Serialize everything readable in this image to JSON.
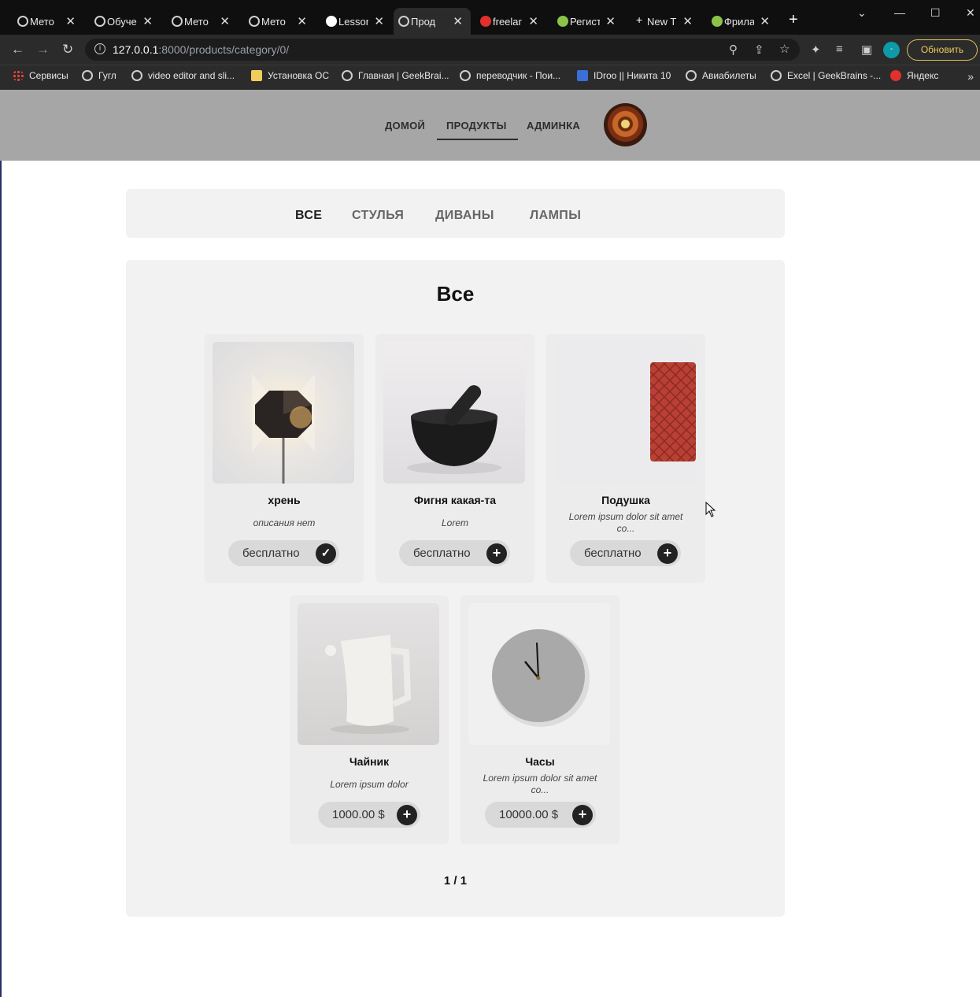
{
  "browser": {
    "tabs": [
      {
        "label": "Мето"
      },
      {
        "label": "Обуче"
      },
      {
        "label": "Мето"
      },
      {
        "label": "Мето"
      },
      {
        "label": "Lessor"
      },
      {
        "label": "Прод"
      },
      {
        "label": "freelar"
      },
      {
        "label": "Регист"
      },
      {
        "label": "New T"
      },
      {
        "label": "Фрила"
      }
    ],
    "url_host": "127.0.0.1",
    "url_rest": ":8000/products/category/0/",
    "profile_initial": "-",
    "update_label": "Обновить",
    "bookmarks": [
      {
        "label": "Сервисы"
      },
      {
        "label": "Гугл"
      },
      {
        "label": "video editor and sli..."
      },
      {
        "label": "Установка ОС"
      },
      {
        "label": "Главная | GeekBrai..."
      },
      {
        "label": "переводчик - Пои..."
      },
      {
        "label": "IDroo || Никита 10"
      },
      {
        "label": "Авиабилеты"
      },
      {
        "label": "Excel | GeekBrains -..."
      },
      {
        "label": "Яндекс"
      }
    ]
  },
  "site": {
    "nav": {
      "home": "ДОМОЙ",
      "products": "ПРОДУКТЫ",
      "admin": "АДМИНКА"
    },
    "categories": [
      "ВСЕ",
      "СТУЛЬЯ",
      "ДИВАНЫ",
      "ЛАМПЫ"
    ],
    "title": "Все",
    "products": [
      {
        "name": "хрень",
        "desc": "описания нет",
        "price": "бесплатно",
        "action": "✓"
      },
      {
        "name": "Фигня какая-та",
        "desc": "Lorem",
        "price": "бесплатно",
        "action": "+"
      },
      {
        "name": "Подушка",
        "desc": "Lorem ipsum dolor sit amet co...",
        "price": "бесплатно",
        "action": "+"
      },
      {
        "name": "Чайник",
        "desc": "Lorem ipsum dolor",
        "price": "1000.00 $",
        "action": "+"
      },
      {
        "name": "Часы",
        "desc": "Lorem ipsum dolor sit amet co...",
        "price": "10000.00 $",
        "action": "+"
      }
    ],
    "pagination": "1 / 1"
  }
}
